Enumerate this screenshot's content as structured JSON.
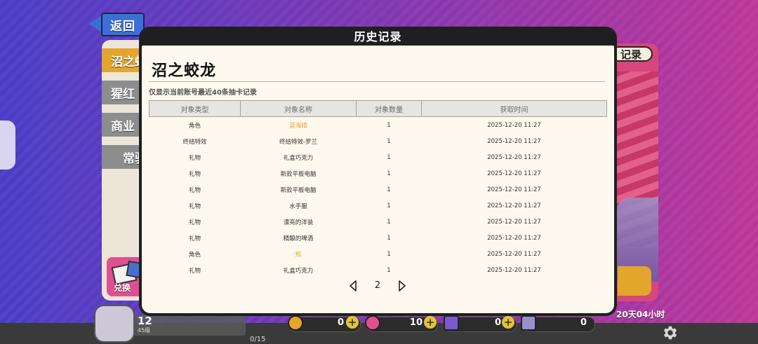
{
  "back_button": {
    "label": "返回"
  },
  "side_tabs": [
    {
      "label": "沼之蛟龙",
      "active": true
    },
    {
      "label": "猩红",
      "active": false
    },
    {
      "label": "商业",
      "active": false
    },
    {
      "label": "常驻",
      "active": false
    }
  ],
  "side_gift": {
    "label": "兑换"
  },
  "right_panel": {
    "pill_label": "记录",
    "timer_text": "20天04小时"
  },
  "modal": {
    "title": "历史记录",
    "pool_name": "沼之蛟龙",
    "notice": "仅显示当前账号最近40条抽卡记录",
    "columns": [
      "对象类型",
      "对象名称",
      "对象数量",
      "获取时间"
    ],
    "rows": [
      {
        "type": "角色",
        "name": "蓝海晴",
        "count": "1",
        "time": "2025-12-20 11:27",
        "highlight": true
      },
      {
        "type": "终结特效",
        "name": "终结特效-罗兰",
        "count": "1",
        "time": "2025-12-20 11:27",
        "highlight": false
      },
      {
        "type": "礼物",
        "name": "礼盒巧克力",
        "count": "1",
        "time": "2025-12-20 11:27",
        "highlight": false
      },
      {
        "type": "礼物",
        "name": "新款平板电脑",
        "count": "1",
        "time": "2025-12-20 11:27",
        "highlight": false
      },
      {
        "type": "礼物",
        "name": "新款平板电脑",
        "count": "1",
        "time": "2025-12-20 11:27",
        "highlight": false
      },
      {
        "type": "礼物",
        "name": "水手服",
        "count": "1",
        "time": "2025-12-20 11:27",
        "highlight": false
      },
      {
        "type": "礼物",
        "name": "漂亮的洋装",
        "count": "1",
        "time": "2025-12-20 11:27",
        "highlight": false
      },
      {
        "type": "礼物",
        "name": "精酿的啤酒",
        "count": "1",
        "time": "2025-12-20 11:27",
        "highlight": false
      },
      {
        "type": "角色",
        "name": "照",
        "count": "1",
        "time": "2025-12-20 11:27",
        "highlight": true
      },
      {
        "type": "礼物",
        "name": "礼盒巧克力",
        "count": "1",
        "time": "2025-12-20 11:27",
        "highlight": false
      }
    ],
    "page": "2"
  },
  "player": {
    "level": "12",
    "level_sub": "45级",
    "progress": "0/15"
  },
  "currencies": [
    {
      "icon": "gold-coin-icon",
      "value": "0",
      "color": "#e3a52c"
    },
    {
      "icon": "gem-icon",
      "value": "10",
      "color": "#e05090"
    },
    {
      "icon": "ticket-icon",
      "value": "0",
      "color": "#7a5ad0"
    },
    {
      "icon": "card-icon",
      "value": "0",
      "color": "#9a90c9"
    }
  ],
  "colors": {
    "accent_gold": "#e3a52c",
    "back_blue": "#3a6fd8",
    "modal_bg": "#fdf9ee"
  }
}
